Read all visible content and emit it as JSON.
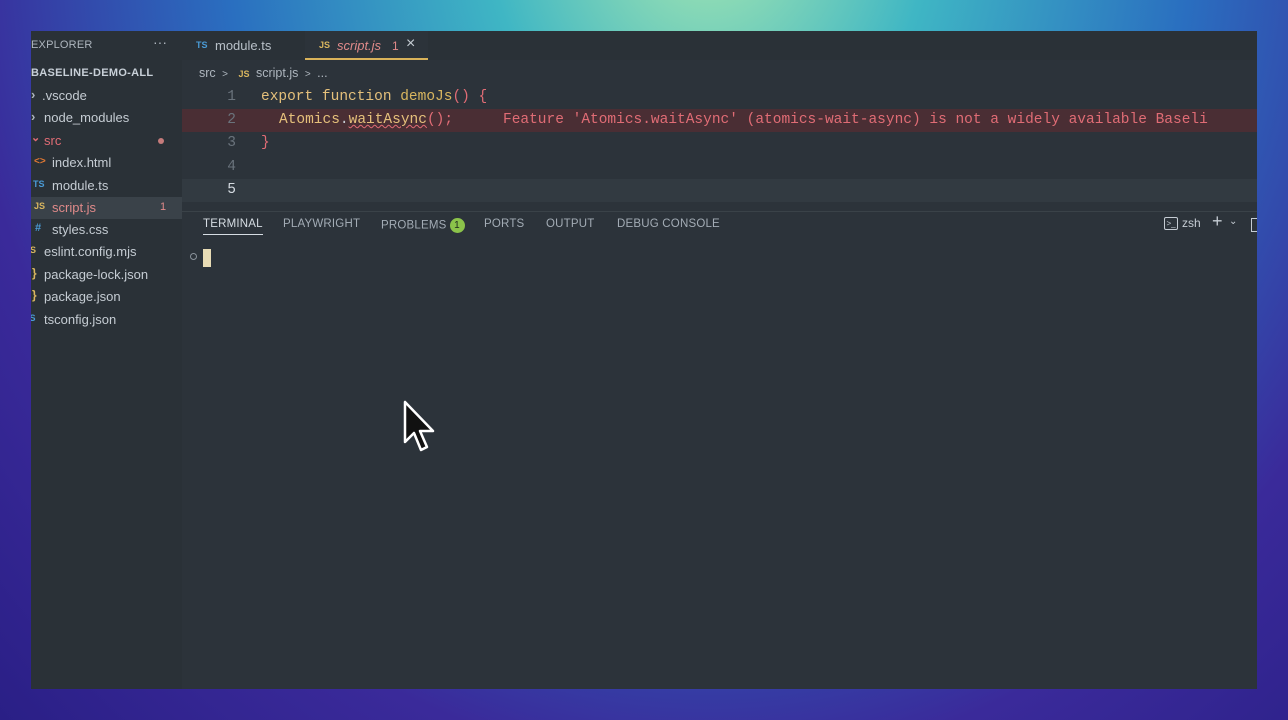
{
  "sidebar": {
    "title": "EXPLORER",
    "more": "···",
    "root": "BASELINE-DEMO-ALL",
    "items": [
      {
        "label": ".vscode",
        "icon": "›",
        "icon_color": "#aeb6be"
      },
      {
        "label": "node_modules",
        "icon": "›",
        "icon_color": "#aeb6be"
      },
      {
        "label": "src",
        "icon": "⌄",
        "icon_color": "#e06c75"
      },
      {
        "label": "index.html",
        "icon": "<>",
        "icon_color": "#e37933"
      },
      {
        "label": "module.ts",
        "icon": "TS",
        "icon_color": "#4a9bd6"
      },
      {
        "label": "script.js",
        "icon": "JS",
        "icon_color": "#d9b65f",
        "count": "1"
      },
      {
        "label": "styles.css",
        "icon": "#",
        "icon_color": "#4a9bd6"
      },
      {
        "label": "eslint.config.mjs",
        "icon": "JS",
        "icon_color": "#d9b65f"
      },
      {
        "label": "package-lock.json",
        "icon": "}",
        "icon_color": "#d9b65f"
      },
      {
        "label": "package.json",
        "icon": "}",
        "icon_color": "#d9b65f"
      },
      {
        "label": "tsconfig.json",
        "icon": "TS",
        "icon_color": "#4a9bd6"
      }
    ]
  },
  "tabs": [
    {
      "icon": "TS",
      "label": "module.ts"
    },
    {
      "icon": "JS",
      "label": "script.js",
      "count": "1",
      "close": "×"
    }
  ],
  "breadcrumb": {
    "folder": "src",
    "sep": ">",
    "icon": "JS",
    "file": "script.js",
    "tail": "..."
  },
  "editor": {
    "line_numbers": [
      "1",
      "2",
      "3",
      "4",
      "5"
    ],
    "line1_kw": "export function ",
    "line1_fn": "demoJs",
    "line1_punc": "() {",
    "line2_obj": "Atomics",
    "line2_dot": ".",
    "line2_call": "waitAsync",
    "line2_rest": "();",
    "line2_diag": "Feature 'Atomics.waitAsync' (atomics-wait-async) is not a widely available Baseli",
    "line3": "}"
  },
  "panel": {
    "tabs": [
      "TERMINAL",
      "PLAYWRIGHT",
      "PROBLEMS",
      "PORTS",
      "OUTPUT",
      "DEBUG CONSOLE"
    ],
    "problems_count": "1",
    "shell": "zsh",
    "plus": "+",
    "chevron": "⌄"
  },
  "colors": {
    "accent": "#d8b25a",
    "error": "#e06c75",
    "badge": "#8bc34a"
  }
}
